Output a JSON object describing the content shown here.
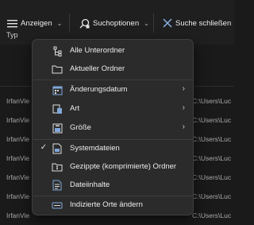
{
  "toolbar": {
    "view_label": "Anzeigen",
    "search_options_label": "Suchoptionen",
    "close_search_label": "Suche schließen"
  },
  "list": {
    "type_header": "Typ",
    "rows": [
      {
        "type": "IrfanVie",
        "path": "C:\\Users\\Luc"
      },
      {
        "type": "IrfanVie",
        "path": "C:\\Users\\Luc"
      },
      {
        "type": "IrfanVie",
        "path": "C:\\Users\\Luc"
      },
      {
        "type": "IrfanVie",
        "path": "C:\\Users\\Luc"
      },
      {
        "type": "IrfanVie",
        "path": "C:\\Users\\Luc"
      },
      {
        "type": "IrfanVie",
        "path": "C:\\Users\\Luc"
      },
      {
        "type": "IrfanVie",
        "path": "C:\\Users\\Luc"
      }
    ]
  },
  "menu": {
    "all_subfolders": "Alle Unterordner",
    "current_folder": "Aktueller Ordner",
    "date_modified": "Änderungsdatum",
    "kind": "Art",
    "size": "Größe",
    "system_files": "Systemdateien",
    "zipped_folders": "Gezippte (komprimierte) Ordner",
    "file_contents": "Dateiinhalte",
    "change_indexed_locations": "Indizierte Orte ändern",
    "system_files_checked": true
  }
}
